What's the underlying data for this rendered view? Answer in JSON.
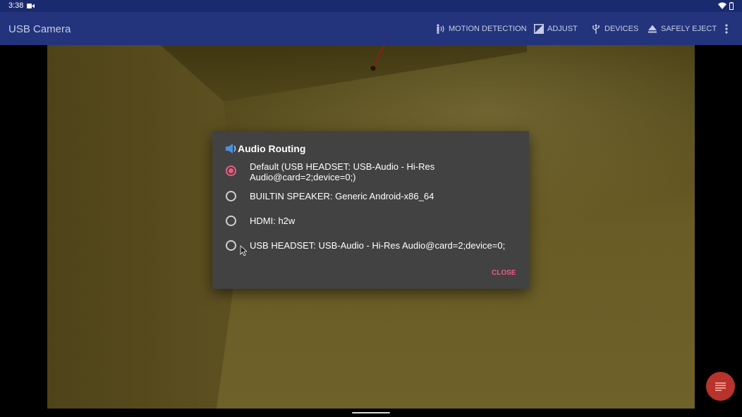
{
  "status_bar": {
    "time": "3:38"
  },
  "app_bar": {
    "title": "USB Camera",
    "actions": {
      "motion_detection": "MOTION DETECTION",
      "adjust": "ADJUST",
      "devices": "DEVICES",
      "safely_eject": "SAFELY EJECT"
    }
  },
  "dialog": {
    "title": "Audio Routing",
    "options": [
      {
        "label": "Default (USB HEADSET: USB-Audio - Hi-Res Audio@card=2;device=0;)",
        "selected": true
      },
      {
        "label": "BUILTIN SPEAKER: Generic Android-x86_64",
        "selected": false
      },
      {
        "label": "HDMI: h2w",
        "selected": false
      },
      {
        "label": "USB HEADSET: USB-Audio - Hi-Res Audio@card=2;device=0;",
        "selected": false
      }
    ],
    "close_label": "CLOSE"
  },
  "colors": {
    "app_bar": "#23347d",
    "status_bar": "#1a2a6e",
    "dialog_bg": "#424242",
    "accent": "#ef5a7e",
    "fab": "#b8332b"
  }
}
